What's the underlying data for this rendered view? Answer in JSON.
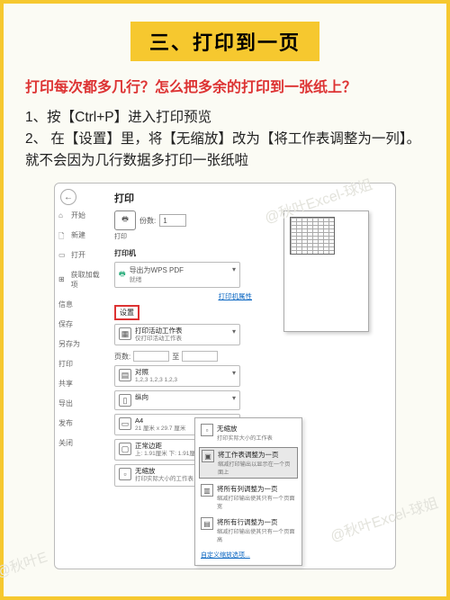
{
  "title": "三、打印到一页",
  "subtitle": "打印每次都多几行？怎么把多余的打印到一张纸上？",
  "steps": "1、按【Ctrl+P】进入打印预览\n2、 在【设置】里，将【无缩放】改为【将工作表调整为一列】。就不会因为几行数据多打印一张纸啦",
  "watermark": "@秋叶Excel-球姐",
  "watermark2": "@秋叶E",
  "print": {
    "heading": "打印",
    "copies_label": "份数:",
    "copies_value": "1",
    "print_btn_sub": "打印",
    "printer_label": "打印机",
    "printer_name": "导出为WPS PDF",
    "printer_status": "就绪",
    "printer_props": "打印机属性",
    "settings_label": "设置",
    "opt_active": {
      "t1": "打印活动工作表",
      "t2": "仅打印活动工作表"
    },
    "pages_label": "页数:",
    "pages_to": "至",
    "opt_collate": {
      "t1": "对照",
      "t2": "1,2,3   1,2,3   1,2,3"
    },
    "opt_orient": {
      "t1": "纵向",
      "t2": ""
    },
    "opt_paper": {
      "t1": "A4",
      "t2": "21 厘米 x 29.7 厘米"
    },
    "opt_margin": {
      "t1": "正常边距",
      "t2": "上: 1.91厘米 下: 1.91厘米"
    },
    "opt_scale": {
      "t1": "无缩放",
      "t2": "打印实际大小的工作表"
    }
  },
  "left_nav": [
    "开始",
    "新建",
    "打开",
    "获取加载项",
    "信息",
    "保存",
    "另存为",
    "打印",
    "共享",
    "导出",
    "发布",
    "关闭"
  ],
  "scaling_options": [
    {
      "t1": "无缩放",
      "t2": "打印实际大小的工作表"
    },
    {
      "t1": "将工作表调整为一页",
      "t2": "缩减打印输出以显示在一个页面上"
    },
    {
      "t1": "将所有列调整为一页",
      "t2": "缩减打印输出使其只有一个页面宽"
    },
    {
      "t1": "将所有行调整为一页",
      "t2": "缩减打印输出使其只有一个页面高"
    }
  ],
  "scaling_link": "自定义缩放选项..."
}
